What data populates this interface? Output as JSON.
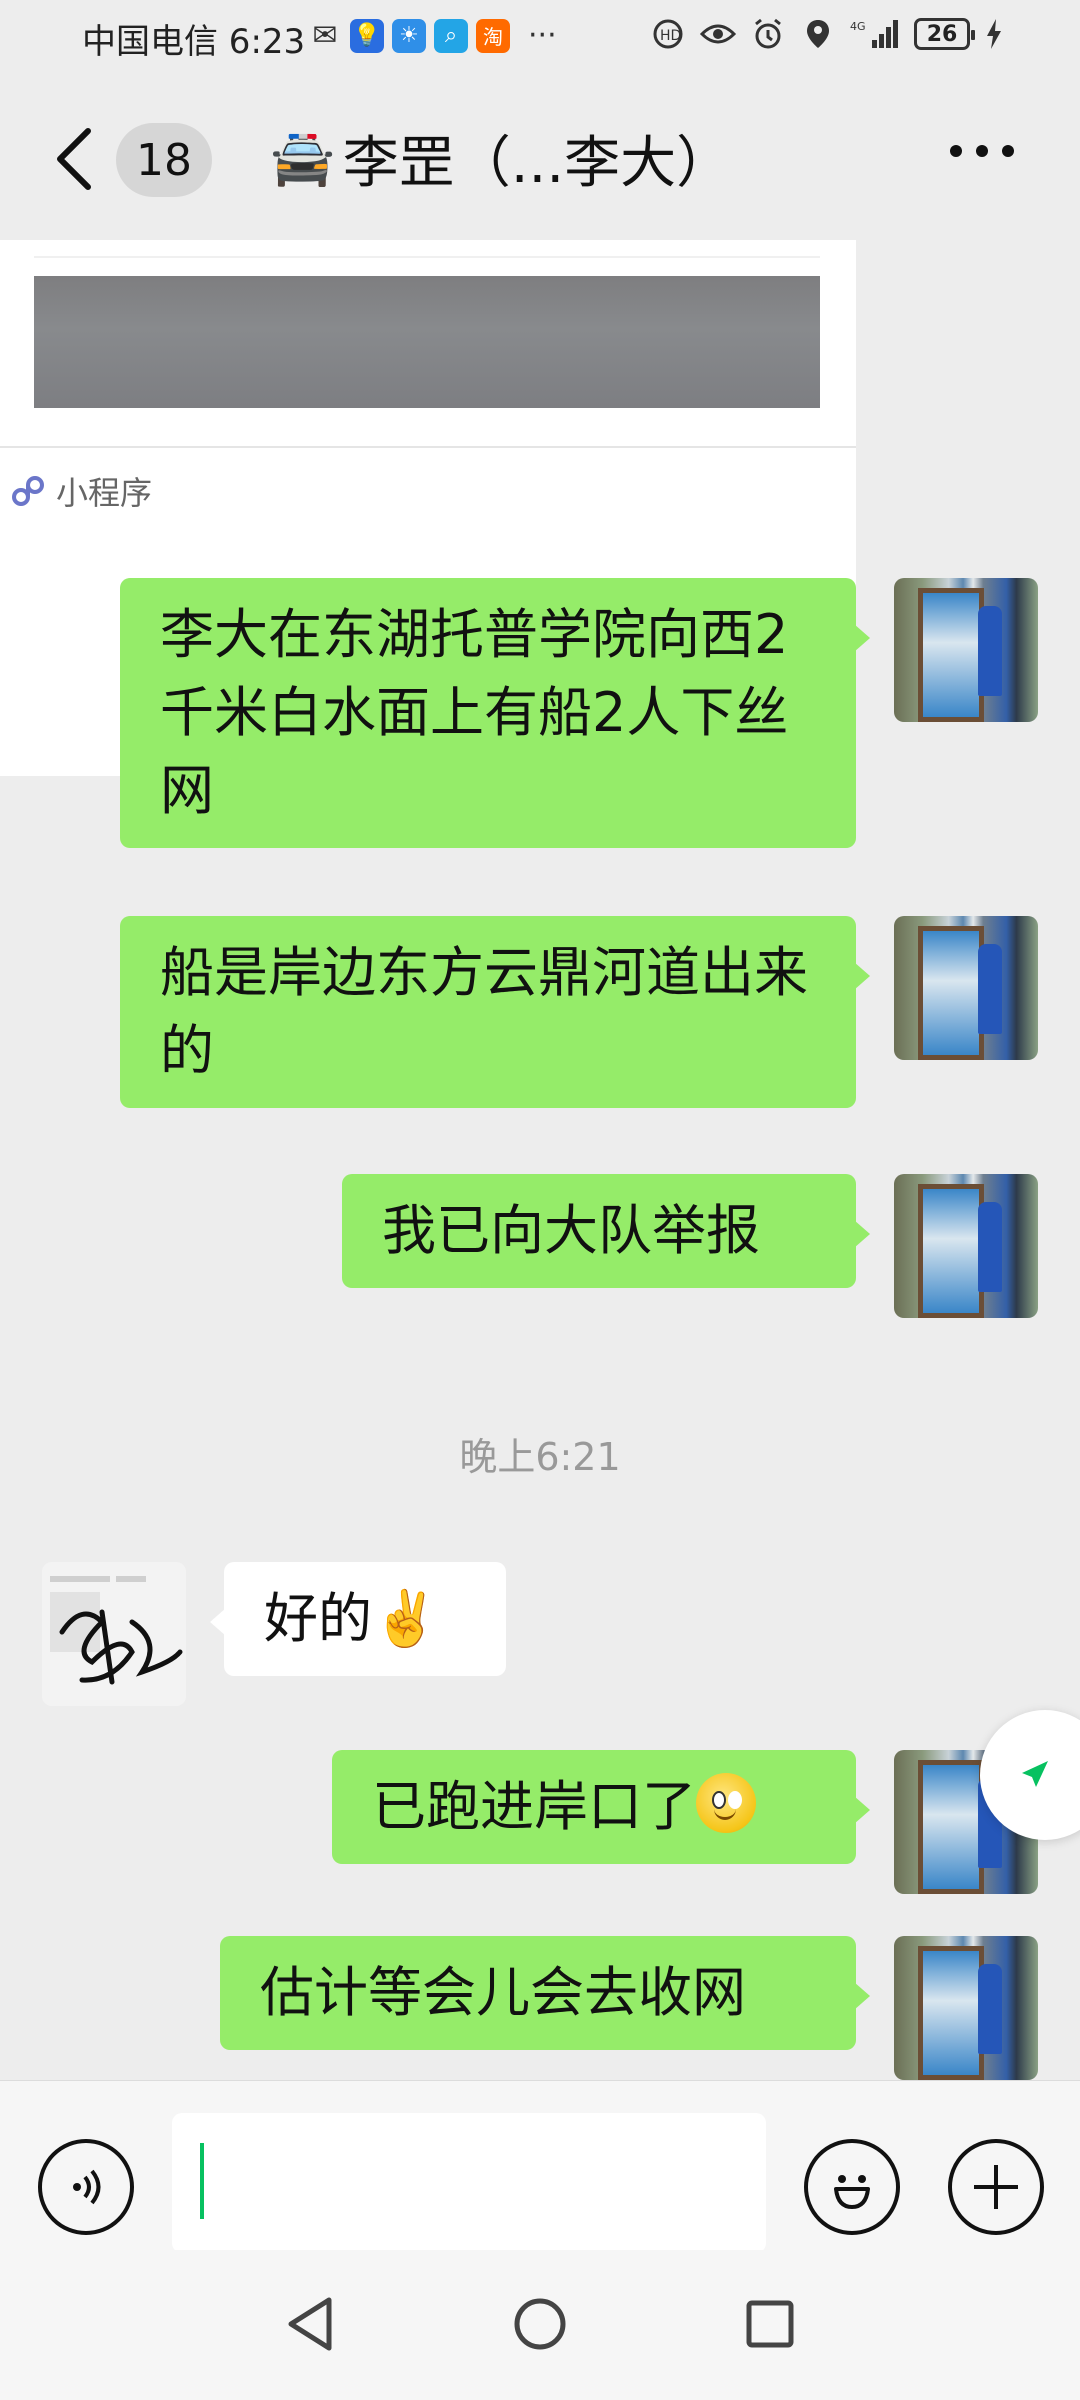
{
  "status_bar": {
    "carrier_time": "中国电信 6:23",
    "more": "···",
    "network": "4G",
    "battery": "26"
  },
  "header": {
    "unread_count": "18",
    "title_emoji": "🚔",
    "title": "李罡（...李大）"
  },
  "mini_program": {
    "label": "小程序"
  },
  "messages": [
    {
      "side": "right",
      "text": "李大在东湖托普学院向西2千米白水面上有船2人下丝网"
    },
    {
      "side": "right",
      "text": "船是岸边东方云鼎河道出来的"
    },
    {
      "side": "right",
      "text": "我已向大队举报"
    },
    {
      "side": "left",
      "text": "好的✌️"
    },
    {
      "side": "right",
      "text": "已跑进岸口了"
    },
    {
      "side": "right",
      "text": "估计等会儿会去收网"
    }
  ],
  "timestamp": "晚上6:21",
  "input": {
    "value": ""
  },
  "colors": {
    "background": "#ededed",
    "bubble_self": "#95ec69",
    "bubble_other": "#ffffff",
    "accent": "#07c160"
  }
}
